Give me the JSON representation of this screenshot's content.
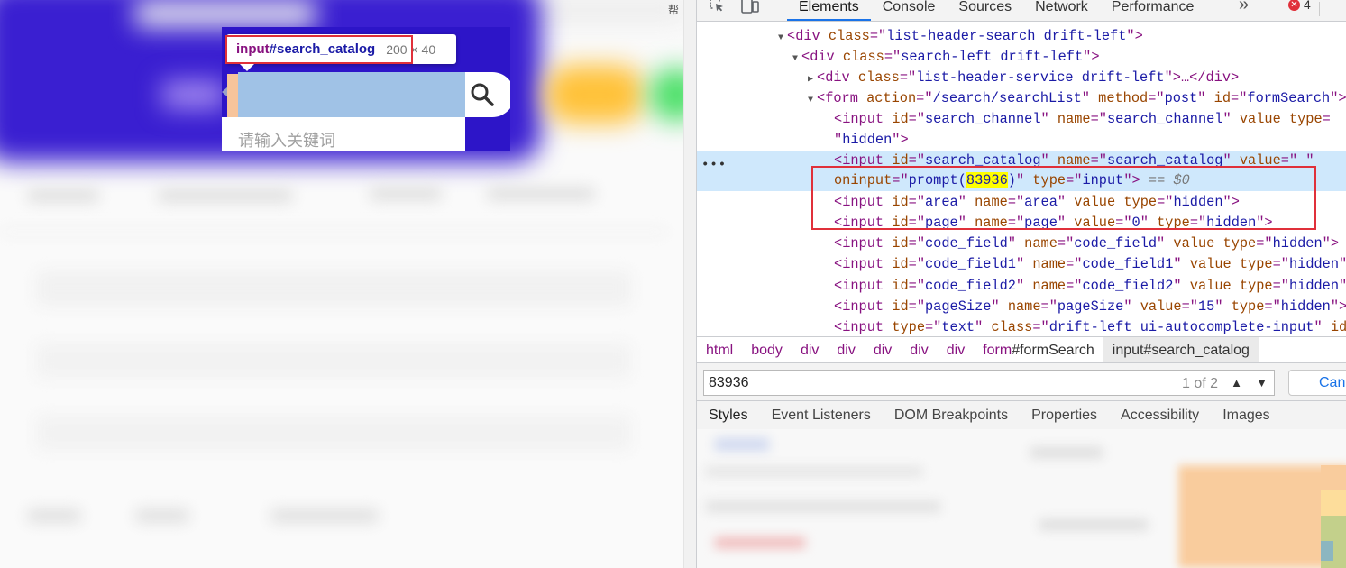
{
  "page": {
    "tooltip": {
      "tag": "input",
      "id_part": "#search_catalog",
      "dimensions": "200 × 40"
    },
    "input_placeholder": "请输入关键词",
    "scrollbar_glyph": "帮"
  },
  "devtools": {
    "tabs": [
      "Elements",
      "Console",
      "Sources",
      "Network",
      "Performance"
    ],
    "active_tab": "Elements",
    "more_tabs": "»",
    "error_count": "4",
    "error_glyph": "✕",
    "dom": {
      "l1": {
        "tag": "div",
        "attr": "class",
        "val": "list-header-search drift-left"
      },
      "l2": {
        "tag": "div",
        "attr": "class",
        "val": "search-left drift-left"
      },
      "l3": {
        "tag": "div",
        "attr": "class",
        "val": "list-header-service drift-left",
        "collapsed": "…</div>"
      },
      "l4": {
        "tag": "form",
        "a1": "action",
        "v1": "/search/searchList",
        "a2": "method",
        "v2": "post",
        "a3": "id",
        "v3": "formSearch"
      },
      "l5": {
        "tag": "input",
        "a1": "id",
        "v1": "search_channel",
        "a2": "name",
        "v2": "search_channel",
        "a3": "value",
        "a4": "type",
        "v4": "hidden"
      },
      "sel": {
        "tag": "input",
        "a1": "id",
        "v1": "search_catalog",
        "a2": "name",
        "v2": "search_catalog",
        "a3": "value",
        "v3": " ",
        "a4": "oninput",
        "v4a": "prompt(",
        "v4hl": "83936",
        "v4b": ")",
        "a5": "type",
        "v5": "input",
        "eq": "== $0"
      },
      "l7": {
        "tag": "input",
        "a1": "id",
        "v1": "area",
        "a2": "name",
        "v2": "area",
        "a3": "value",
        "a4": "type",
        "v4": "hidden"
      },
      "l8": {
        "tag": "input",
        "a1": "id",
        "v1": "page",
        "a2": "name",
        "v2": "page",
        "a3": "value",
        "v3": "0",
        "a4": "type",
        "v4": "hidden"
      },
      "l9": {
        "tag": "input",
        "a1": "id",
        "v1": "code_field",
        "a2": "name",
        "v2": "code_field",
        "a3": "value",
        "a4": "type",
        "v4": "hidden"
      },
      "l10": {
        "tag": "input",
        "a1": "id",
        "v1": "code_field1",
        "a2": "name",
        "v2": "code_field1",
        "a3": "value",
        "a4": "type",
        "v4": "hidden"
      },
      "l11": {
        "tag": "input",
        "a1": "id",
        "v1": "code_field2",
        "a2": "name",
        "v2": "code_field2",
        "a3": "value",
        "a4": "type",
        "v4": "hidden"
      },
      "l12": {
        "tag": "input",
        "a1": "id",
        "v1": "pageSize",
        "a2": "name",
        "v2": "pageSize",
        "a3": "value",
        "v3": "15",
        "a4": "type",
        "v4": "hidden"
      },
      "l13": {
        "tag": "input",
        "a1": "type",
        "v1": "text",
        "a2": "class",
        "v2": "drift-left ui-autocomplete-input",
        "a3": "id="
      }
    },
    "breadcrumbs": [
      "html",
      "body",
      "div",
      "div",
      "div",
      "div",
      "div"
    ],
    "crumb_form": {
      "tag": "form",
      "id": "#formSearch"
    },
    "crumb_input": {
      "tag": "input",
      "id": "#search_catalog"
    },
    "search": {
      "query": "83936",
      "count": "1 of 2",
      "up": "▲",
      "down": "▼",
      "cancel": "Cancel"
    },
    "lower_tabs": [
      "Styles",
      "Event Listeners",
      "DOM Breakpoints",
      "Properties",
      "Accessibility",
      "Images"
    ]
  },
  "colors": {
    "highlight_red": "#e0303a",
    "selection_bg": "#cfe8fc",
    "site_brand": "#2d15c8",
    "input_overlay": "#a0c2e6"
  }
}
